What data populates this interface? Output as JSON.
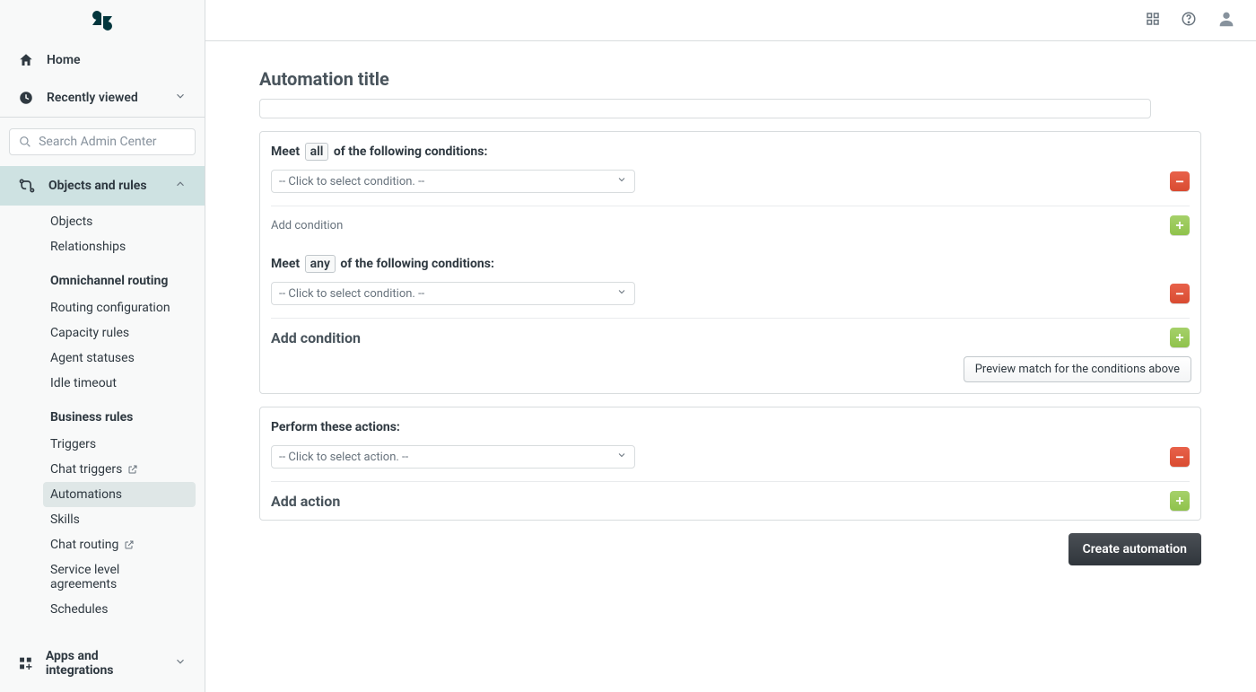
{
  "sidebar": {
    "home": "Home",
    "recently_viewed": "Recently viewed",
    "search_placeholder": "Search Admin Center",
    "objects_and_rules": "Objects and rules",
    "items": {
      "objects": "Objects",
      "relationships": "Relationships"
    },
    "group_omni": "Omnichannel routing",
    "omni": {
      "routing_config": "Routing configuration",
      "capacity_rules": "Capacity rules",
      "agent_statuses": "Agent statuses",
      "idle_timeout": "Idle timeout"
    },
    "group_business": "Business rules",
    "business": {
      "triggers": "Triggers",
      "chat_triggers": "Chat triggers",
      "automations": "Automations",
      "skills": "Skills",
      "chat_routing": "Chat routing",
      "sla": "Service level agreements",
      "schedules": "Schedules"
    },
    "apps": "Apps and integrations"
  },
  "main": {
    "page_title": "Automation title",
    "conditions": {
      "meet_prefix": "Meet",
      "all_chip": "all",
      "any_chip": "any",
      "suffix": "of the following conditions:",
      "select_placeholder": "-- Click to select condition. --",
      "add_condition": "Add condition",
      "preview": "Preview match for the conditions above"
    },
    "actions": {
      "header": "Perform these actions:",
      "select_placeholder": "-- Click to select action. --",
      "add_action": "Add action"
    },
    "create_button": "Create automation"
  }
}
